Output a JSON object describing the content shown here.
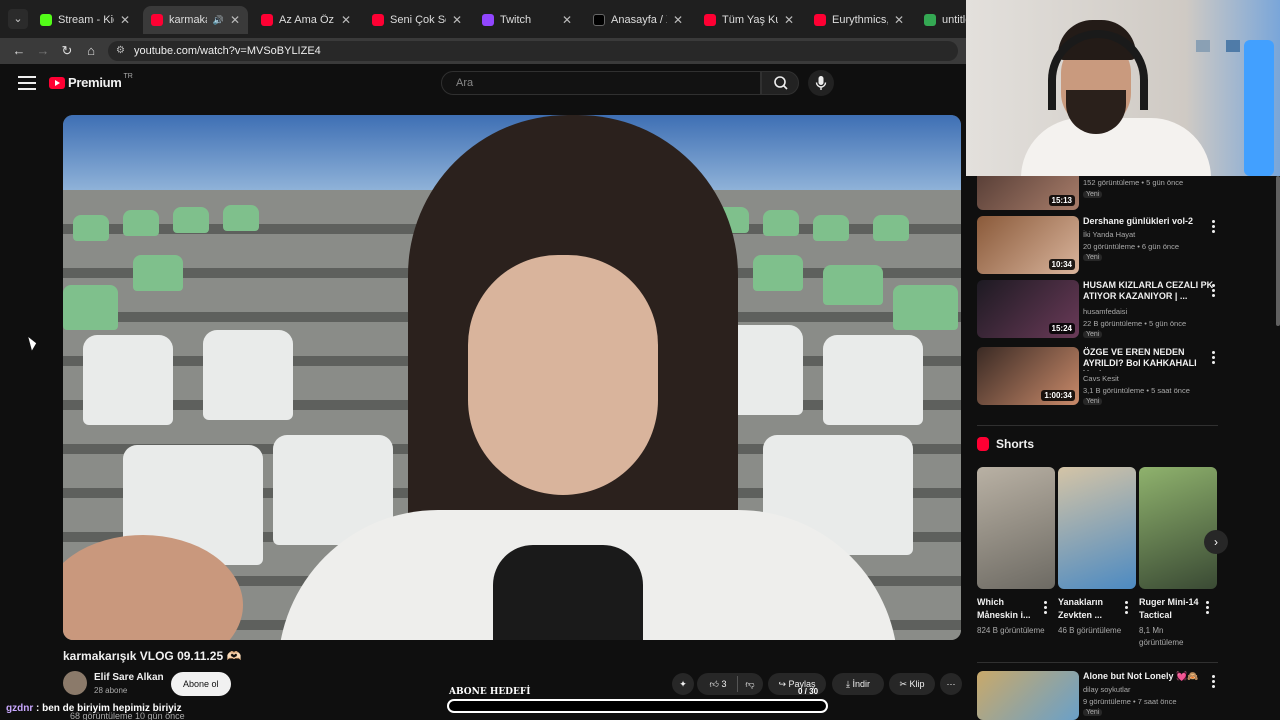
{
  "tabs": [
    {
      "title": "Stream - Kick Dash",
      "fav": "#53fc18",
      "active": false
    },
    {
      "title": "karmakarışık V",
      "fav": "#ff0033",
      "active": true
    },
    {
      "title": "Az Ama Öz - YouT",
      "fav": "#ff0033",
      "active": false
    },
    {
      "title": "Seni Çok Seviyoru",
      "fav": "#ff0033",
      "active": false
    },
    {
      "title": "Twitch",
      "fav": "#9146ff",
      "active": false
    },
    {
      "title": "Anasayfa / X",
      "fav": "#000000",
      "active": false
    },
    {
      "title": "Tüm Yaş Kuşakları",
      "fav": "#ff0033",
      "active": false
    },
    {
      "title": "Eurythmics, Annie",
      "fav": "#ff0033",
      "active": false
    },
    {
      "title": "untitled",
      "fav": "#34a853",
      "active": false
    }
  ],
  "address": {
    "url": "youtube.com/watch?v=MVSoBYLIZE4"
  },
  "header": {
    "brand": "Premium",
    "region": "TR",
    "search_placeholder": "Ara"
  },
  "video": {
    "title": "karmakarışık VLOG 09.11.25 🫶🏻",
    "channel": "Elif Sare Alkan",
    "subscribers": "28 abone",
    "subscribe_label": "Abone ol",
    "likes": "3",
    "share_label": "Paylaş",
    "download_label": "İndir",
    "clip_label": "Klip",
    "meta": "68 görüntüleme  10 gün önce"
  },
  "overlay": {
    "chat_user": "gzdnr",
    "chat_message": " : ben de biriyim hepimiz biriyiz",
    "goal_label": "ABONE HEDEFİ",
    "goal_count": "0 / 30",
    "goal_progress": 0
  },
  "recommendations": [
    {
      "title": "",
      "channel": "",
      "stats": "152 görüntüleme • 5 gün önce",
      "badge": "Yeni",
      "duration": "15:13",
      "colors": [
        "#5a4038",
        "#a87d6a"
      ]
    },
    {
      "title": "Dershane günlükleri vol-2",
      "channel": "İki Yanda Hayat",
      "stats": "20 görüntüleme • 6 gün önce",
      "badge": "Yeni",
      "duration": "10:34",
      "colors": [
        "#8a5a3a",
        "#d9b49c"
      ]
    },
    {
      "title": "HUSAM KIZLARLA CEZALI PK ATIYOR KAZANIYOR | ...",
      "channel": "husamfedaisi",
      "stats": "22 B görüntüleme • 5 gün önce",
      "badge": "Yeni",
      "duration": "15:24",
      "colors": [
        "#1d1a22",
        "#6a3a58"
      ]
    },
    {
      "title": "ÖZGE VE EREN NEDEN AYRILDI? Bol KAHKAHALI Yeni...",
      "channel": "Cavs Kesit",
      "stats": "3,1 B görüntüleme • 5 saat önce",
      "badge": "Yeni",
      "duration": "1:00:34",
      "colors": [
        "#3a2a24",
        "#c98a6a"
      ]
    }
  ],
  "shorts": {
    "heading": "Shorts",
    "items": [
      {
        "title": "Which Måneskin i...",
        "views": "824 B görüntüleme",
        "colors": [
          "#b9b1a4",
          "#6d6a63"
        ]
      },
      {
        "title": "Yanakların Zevkten ...",
        "views": "46 B görüntüleme",
        "colors": [
          "#d4c4a6",
          "#4c8ac2"
        ]
      },
      {
        "title": "Ruger Mini-14 Tactical",
        "views": "8,1 Mn görüntüleme",
        "colors": [
          "#8fb26d",
          "#3a4a34"
        ]
      }
    ]
  },
  "bottom_rec": {
    "title": "Alone but Not Lonely 💓🙈",
    "channel": "dilay soykutlar",
    "stats": "9 görüntüleme • 7 saat önce",
    "badge": "Yeni",
    "colors": [
      "#c9a96a",
      "#6aa0c8"
    ]
  }
}
